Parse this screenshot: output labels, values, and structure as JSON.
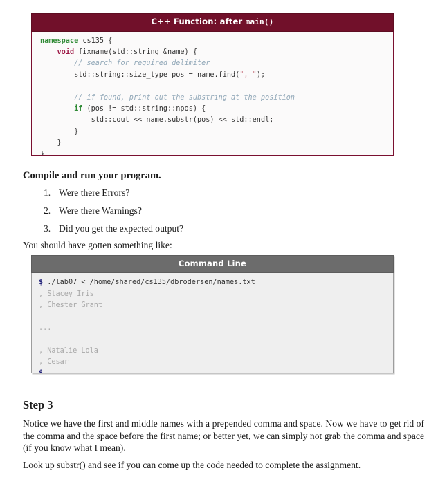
{
  "cpp_block": {
    "title_prefix": "C++ Function: after ",
    "title_mono": "main()",
    "header_color": "#71102a",
    "border_color": "#7a1030",
    "lines": [
      {
        "indent": 0,
        "tokens": [
          {
            "t": "kw",
            "v": "namespace"
          },
          {
            "t": "pln",
            "v": " cs135 {"
          }
        ]
      },
      {
        "indent": 1,
        "tokens": [
          {
            "t": "kw2",
            "v": "void"
          },
          {
            "t": "pln",
            "v": " fixname(std::string &name) {"
          }
        ]
      },
      {
        "indent": 2,
        "tokens": [
          {
            "t": "cmt",
            "v": "// search for required delimiter"
          }
        ]
      },
      {
        "indent": 2,
        "tokens": [
          {
            "t": "pln",
            "v": "std::string::size_type pos = name.find("
          },
          {
            "t": "str",
            "v": "\", \""
          },
          {
            "t": "pln",
            "v": ");"
          }
        ]
      },
      {
        "indent": 0,
        "tokens": [
          {
            "t": "pln",
            "v": ""
          }
        ]
      },
      {
        "indent": 2,
        "tokens": [
          {
            "t": "cmt",
            "v": "// if found, print out the substring at the position"
          }
        ]
      },
      {
        "indent": 2,
        "tokens": [
          {
            "t": "kw",
            "v": "if"
          },
          {
            "t": "pln",
            "v": " (pos != std::string::npos) {"
          }
        ]
      },
      {
        "indent": 3,
        "tokens": [
          {
            "t": "pln",
            "v": "std::cout << name.substr(pos) << std::endl;"
          }
        ]
      },
      {
        "indent": 2,
        "tokens": [
          {
            "t": "pln",
            "v": "}"
          }
        ]
      },
      {
        "indent": 1,
        "tokens": [
          {
            "t": "pln",
            "v": "}"
          }
        ]
      },
      {
        "indent": 0,
        "tokens": [
          {
            "t": "pln",
            "v": "}"
          }
        ]
      }
    ]
  },
  "compile_section": {
    "heading": "Compile and run your program.",
    "questions": [
      "Were there Errors?",
      "Were there Warnings?",
      "Did you get the expected output?"
    ],
    "lead_in": "You should have gotten something like:"
  },
  "cli_block": {
    "title": "Command Line",
    "header_color": "#6c6c6c",
    "border_color": "#9d9d9d",
    "lines": [
      {
        "type": "command",
        "prompt": "$",
        "text": " ./lab07 < /home/shared/cs135/dbrodersen/names.txt"
      },
      {
        "type": "output",
        "text": ", Stacey Iris"
      },
      {
        "type": "output",
        "text": ", Chester Grant"
      },
      {
        "type": "output",
        "text": ""
      },
      {
        "type": "output",
        "text": "..."
      },
      {
        "type": "output",
        "text": ""
      },
      {
        "type": "output",
        "text": ", Natalie Lola"
      },
      {
        "type": "output",
        "text": ", Cesar"
      },
      {
        "type": "command",
        "prompt": "$",
        "text": ""
      }
    ]
  },
  "step3": {
    "heading": "Step 3",
    "paragraph1": "Notice we have the first and middle names with a prepended comma and space. Now we have to get rid of the comma and the space before the first name; or better yet, we can simply not grab the comma and space (if you know what I mean).",
    "paragraph2": "Look up substr() and see if you can come up the code needed to complete the assignment."
  }
}
